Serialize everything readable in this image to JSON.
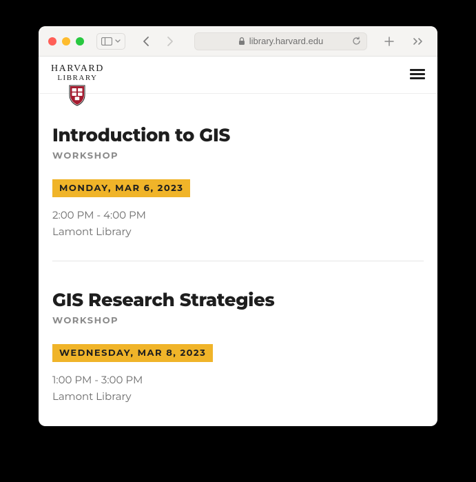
{
  "browser": {
    "url_display": "library.harvard.edu"
  },
  "brand": {
    "line1": "HARVARD",
    "line2": "LIBRARY"
  },
  "events": [
    {
      "title": "Introduction to GIS",
      "type": "WORKSHOP",
      "date": "MONDAY, MAR 6, 2023",
      "time": "2:00 PM - 4:00 PM",
      "location": "Lamont Library"
    },
    {
      "title": "GIS Research Strategies",
      "type": "WORKSHOP",
      "date": "WEDNESDAY, MAR 8, 2023",
      "time": "1:00 PM - 3:00 PM",
      "location": "Lamont Library"
    }
  ]
}
